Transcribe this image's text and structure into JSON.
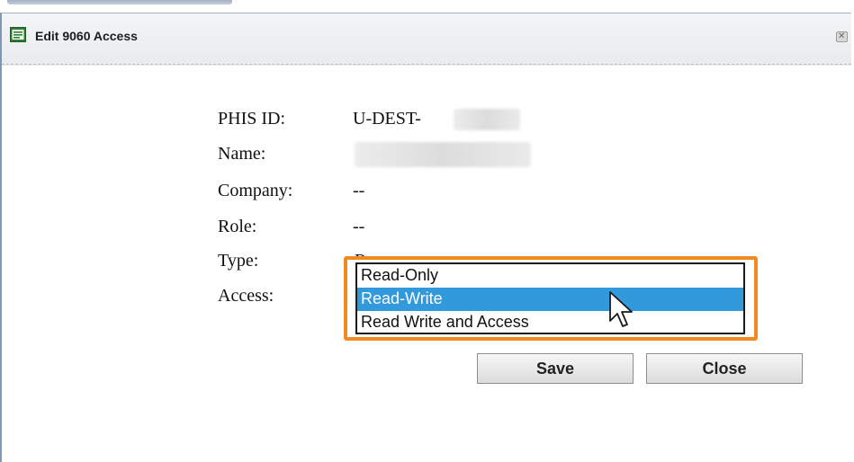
{
  "dialog": {
    "title": "Edit 9060 Access",
    "icon": "form-icon",
    "close_icon": "close-icon"
  },
  "form": {
    "phis_id_label": "PHIS ID:",
    "phis_id_value": "U-DEST-",
    "name_label": "Name:",
    "company_label": "Company:",
    "company_value": "--",
    "role_label": "Role:",
    "role_value": "--",
    "type_label": "Type:",
    "type_value_partial": "R",
    "access_label": "Access:"
  },
  "access_options": [
    {
      "label": "Read-Only",
      "selected": false
    },
    {
      "label": "Read-Write",
      "selected": true
    },
    {
      "label": "Read Write and Access",
      "selected": false
    }
  ],
  "buttons": {
    "save": "Save",
    "close": "Close"
  },
  "colors": {
    "highlight_border": "#f08a20",
    "selected_option": "#3399dd",
    "window_border": "#7f98b6"
  }
}
